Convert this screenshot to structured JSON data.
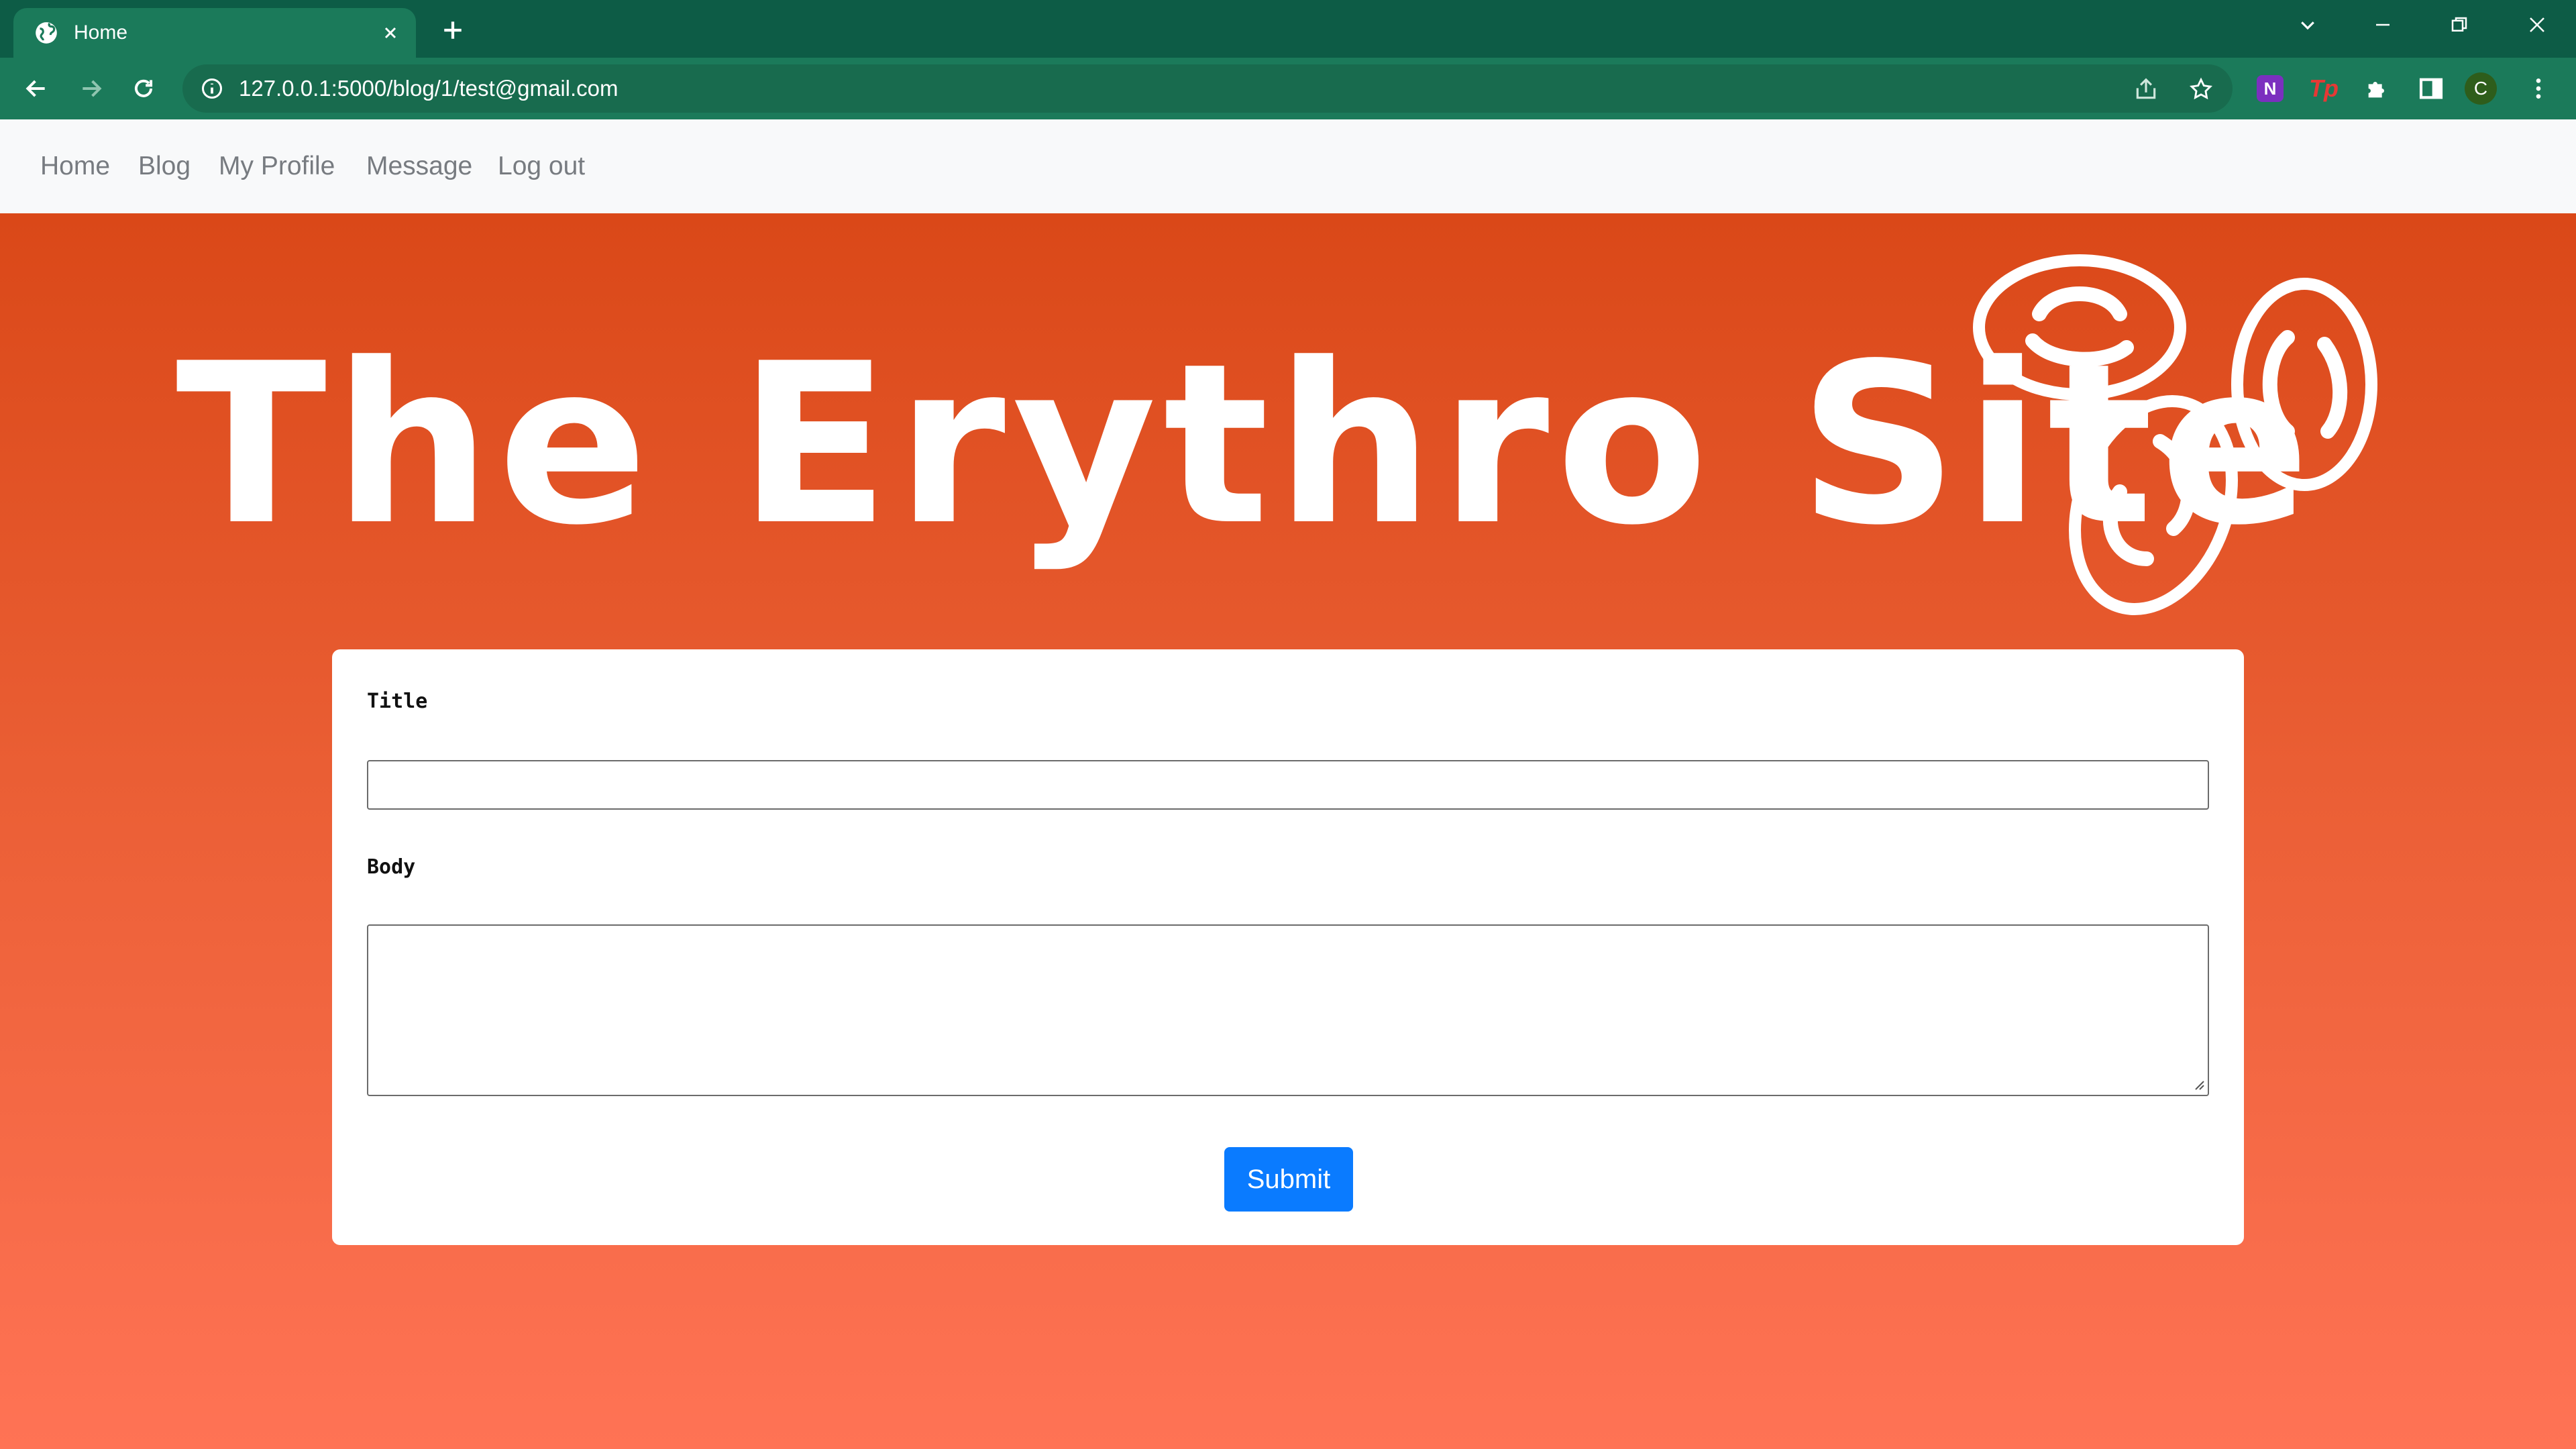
{
  "browser": {
    "tab": {
      "title": "Home",
      "favicon": "globe-icon",
      "close": "close-icon"
    },
    "new_tab": "plus-icon",
    "window_controls": [
      "chevron-down-icon",
      "minimize-icon",
      "restore-icon",
      "close-icon"
    ],
    "url": "127.0.0.1:5000/blog/1/test@gmail.com",
    "profile_initial": "C",
    "extensions": {
      "onenote": "N",
      "tp": "Tp"
    }
  },
  "nav": {
    "items": [
      "Home",
      "Blog",
      "My Profile",
      "Message",
      "Log out"
    ]
  },
  "hero": {
    "title": "The Erythro Site"
  },
  "form": {
    "title_label": "Title",
    "title_value": "",
    "body_label": "Body",
    "body_value": "",
    "submit_label": "Submit"
  },
  "colors": {
    "chrome_dark": "#0d5c46",
    "chrome": "#1b7a5a",
    "gradient_top": "#da4818",
    "gradient_bottom": "#ff7355",
    "button": "#0a7bff"
  }
}
